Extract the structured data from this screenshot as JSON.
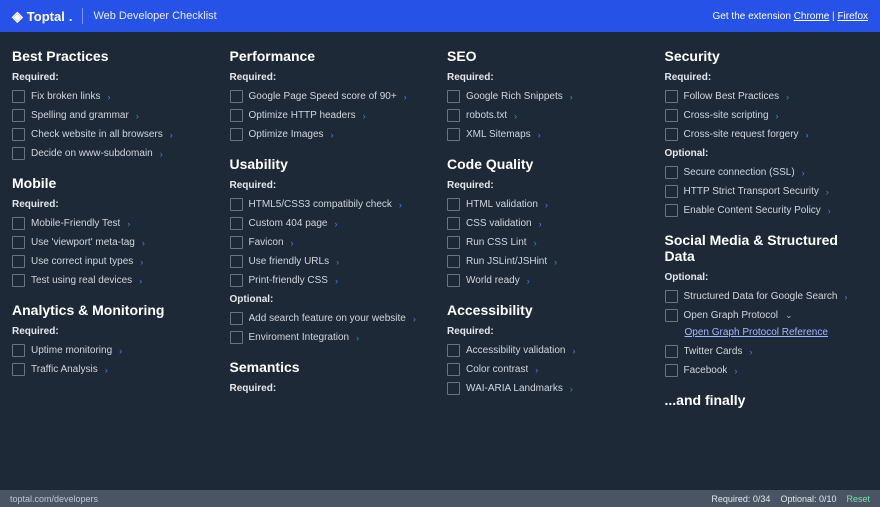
{
  "header": {
    "brand": "Toptal",
    "title": "Web Developer Checklist",
    "get_ext": "Get the extension",
    "chrome": "Chrome",
    "firefox": "Firefox",
    "sep": " | "
  },
  "columns": [
    {
      "sections": [
        {
          "title": "Best Practices",
          "groups": [
            {
              "label": "Required:",
              "items": [
                {
                  "t": "Fix broken links"
                },
                {
                  "t": "Spelling and grammar"
                },
                {
                  "t": "Check website in all browsers"
                },
                {
                  "t": "Decide on www-subdomain"
                }
              ]
            }
          ]
        },
        {
          "title": "Mobile",
          "groups": [
            {
              "label": "Required:",
              "items": [
                {
                  "t": "Mobile-Friendly Test"
                },
                {
                  "t": "Use 'viewport' meta-tag"
                },
                {
                  "t": "Use correct input types"
                },
                {
                  "t": "Test using real devices"
                }
              ]
            }
          ]
        },
        {
          "title": "Analytics & Monitoring",
          "groups": [
            {
              "label": "Required:",
              "items": [
                {
                  "t": "Uptime monitoring"
                },
                {
                  "t": "Traffic Analysis"
                }
              ]
            }
          ]
        }
      ]
    },
    {
      "sections": [
        {
          "title": "Performance",
          "groups": [
            {
              "label": "Required:",
              "items": [
                {
                  "t": "Google Page Speed score of 90+"
                },
                {
                  "t": "Optimize HTTP headers"
                },
                {
                  "t": "Optimize Images"
                }
              ]
            }
          ]
        },
        {
          "title": "Usability",
          "groups": [
            {
              "label": "Required:",
              "items": [
                {
                  "t": "HTML5/CSS3 compatibily check"
                },
                {
                  "t": "Custom 404 page"
                },
                {
                  "t": "Favicon"
                },
                {
                  "t": "Use friendly URLs"
                },
                {
                  "t": "Print-friendly CSS"
                }
              ]
            },
            {
              "label": "Optional:",
              "items": [
                {
                  "t": "Add search feature on your website"
                },
                {
                  "t": "Enviroment Integration"
                }
              ]
            }
          ]
        },
        {
          "title": "Semantics",
          "groups": [
            {
              "label": "Required:",
              "items": []
            }
          ]
        }
      ]
    },
    {
      "sections": [
        {
          "title": "SEO",
          "groups": [
            {
              "label": "Required:",
              "items": [
                {
                  "t": "Google Rich Snippets"
                },
                {
                  "t": "robots.txt"
                },
                {
                  "t": "XML Sitemaps"
                }
              ]
            }
          ]
        },
        {
          "title": "Code Quality",
          "groups": [
            {
              "label": "Required:",
              "items": [
                {
                  "t": "HTML validation"
                },
                {
                  "t": "CSS validation"
                },
                {
                  "t": "Run CSS Lint"
                },
                {
                  "t": "Run JSLint/JSHint"
                },
                {
                  "t": "World ready"
                }
              ]
            }
          ]
        },
        {
          "title": "Accessibility",
          "groups": [
            {
              "label": "Required:",
              "items": [
                {
                  "t": "Accessibility validation"
                },
                {
                  "t": "Color contrast"
                },
                {
                  "t": "WAI-ARIA Landmarks"
                }
              ]
            }
          ]
        }
      ]
    },
    {
      "sections": [
        {
          "title": "Security",
          "groups": [
            {
              "label": "Required:",
              "items": [
                {
                  "t": "Follow Best Practices"
                },
                {
                  "t": "Cross-site scripting"
                },
                {
                  "t": "Cross-site request forgery"
                }
              ]
            },
            {
              "label": "Optional:",
              "items": [
                {
                  "t": "Secure connection (SSL)"
                },
                {
                  "t": "HTTP Strict Transport Security"
                },
                {
                  "t": "Enable Content Security Policy"
                }
              ]
            }
          ]
        },
        {
          "title": "Social Media & Structured Data",
          "groups": [
            {
              "label": "Optional:",
              "items": [
                {
                  "t": "Structured Data for Google Search"
                },
                {
                  "t": "Open Graph Protocol",
                  "open": true,
                  "sublink": "Open Graph Protocol Reference"
                },
                {
                  "t": "Twitter Cards"
                },
                {
                  "t": "Facebook"
                }
              ]
            }
          ]
        },
        {
          "title": "...and finally",
          "groups": []
        }
      ]
    }
  ],
  "footer": {
    "path": "toptal.com/developers",
    "required": "Required: 0/34",
    "optional": "Optional: 0/10",
    "reset": "Reset"
  }
}
